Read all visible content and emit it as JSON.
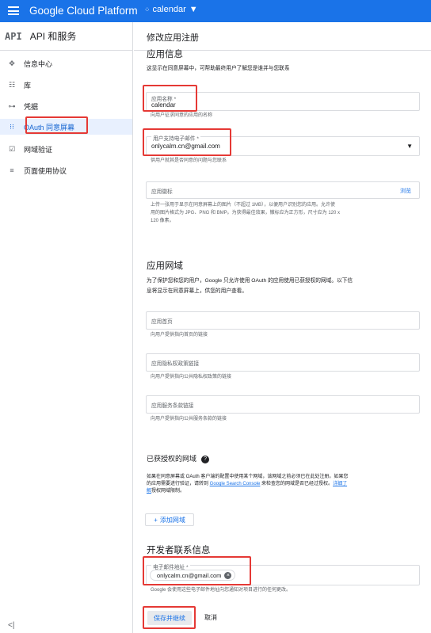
{
  "topbar": {
    "brand": "Google Cloud Platform",
    "project": "calendar"
  },
  "sidebar": {
    "logo": "API",
    "title": "API 和服务",
    "items": [
      {
        "icon": "dashboard-icon",
        "glyph": "✥",
        "label": "信息中心"
      },
      {
        "icon": "library-icon",
        "glyph": "☷",
        "label": "库"
      },
      {
        "icon": "key-icon",
        "glyph": "⊶",
        "label": "凭据"
      },
      {
        "icon": "consent-icon",
        "glyph": "⁝⁝",
        "label": "OAuth 同意屏幕"
      },
      {
        "icon": "domain-verify-icon",
        "glyph": "☑",
        "label": "网域验证"
      },
      {
        "icon": "page-usage-icon",
        "glyph": "≡",
        "label": "页面使用协议"
      }
    ],
    "collapse": "<|"
  },
  "main": {
    "title": "修改应用注册",
    "app_info": {
      "heading": "应用信息",
      "desc": "这显示在同意屏幕中，可帮助最终用户了解您是谁并与您联系",
      "app_name_label": "应用名称 *",
      "app_name_value": "calendar",
      "app_name_hint": "向用户征求同意的应用的名称",
      "email_label": "用户支持电子邮件 *",
      "email_value": "onlycalm.cn@gmail.com",
      "email_hint": "供用户就其是否同意的问题与您联系",
      "logo_label": "应用徽标",
      "logo_browse": "浏览",
      "logo_hint_1": "上传一张用于显示在同意屏幕上的图片（不超过 1MB），以便用户识别您的应用。允许使",
      "logo_hint_2": "用的图片格式为 JPG、PNG 和 BMP。为获得最佳效果，徽标应为正方形，尺寸应为 120 x",
      "logo_hint_3": "120 像素。"
    },
    "app_domain": {
      "heading": "应用网域",
      "desc_1": "为了保护您和您的用户，Google 只允许使用 OAuth 的应用使用已获授权的网域。以下信",
      "desc_2": "息将显示在同意屏幕上，供您的用户查看。",
      "home_label": "应用首页",
      "home_hint": "向用户提供指向首页的链接",
      "privacy_label": "应用隐私权政策链接",
      "privacy_hint": "向用户提供指向公共隐私权政策的链接",
      "tos_label": "应用服务条款链接",
      "tos_hint": "向用户提供指向公共服务条款的链接"
    },
    "authorized": {
      "heading": "已获授权的网域",
      "text_1": "如果在同意屏幕或 OAuth 客户端的配置中使用某个网域，该网域之前必须已在此处注册。如果您",
      "text_2a": "的应用需要进行验证，请转到 ",
      "text_2_link": "Google Search Console",
      "text_2b": " 来检查您的网域是否已经过授权。",
      "text_2_link2": "详细了",
      "text_3_link": "解",
      "text_3b": "授权网域限制。",
      "add_button": "添加网域"
    },
    "developer": {
      "heading": "开发者联系信息",
      "email_label": "电子邮件地址 *",
      "chip": "onlycalm.cn@gmail.com",
      "hint": "Google 会使用这些电子邮件地址向您通知对项目进行的任何更改。"
    },
    "buttons": {
      "save": "保存并继续",
      "cancel": "取消"
    }
  },
  "colors": {
    "accent": "#1a73e8",
    "highlight": "#e53935",
    "active_bg": "#e8f0fe"
  }
}
